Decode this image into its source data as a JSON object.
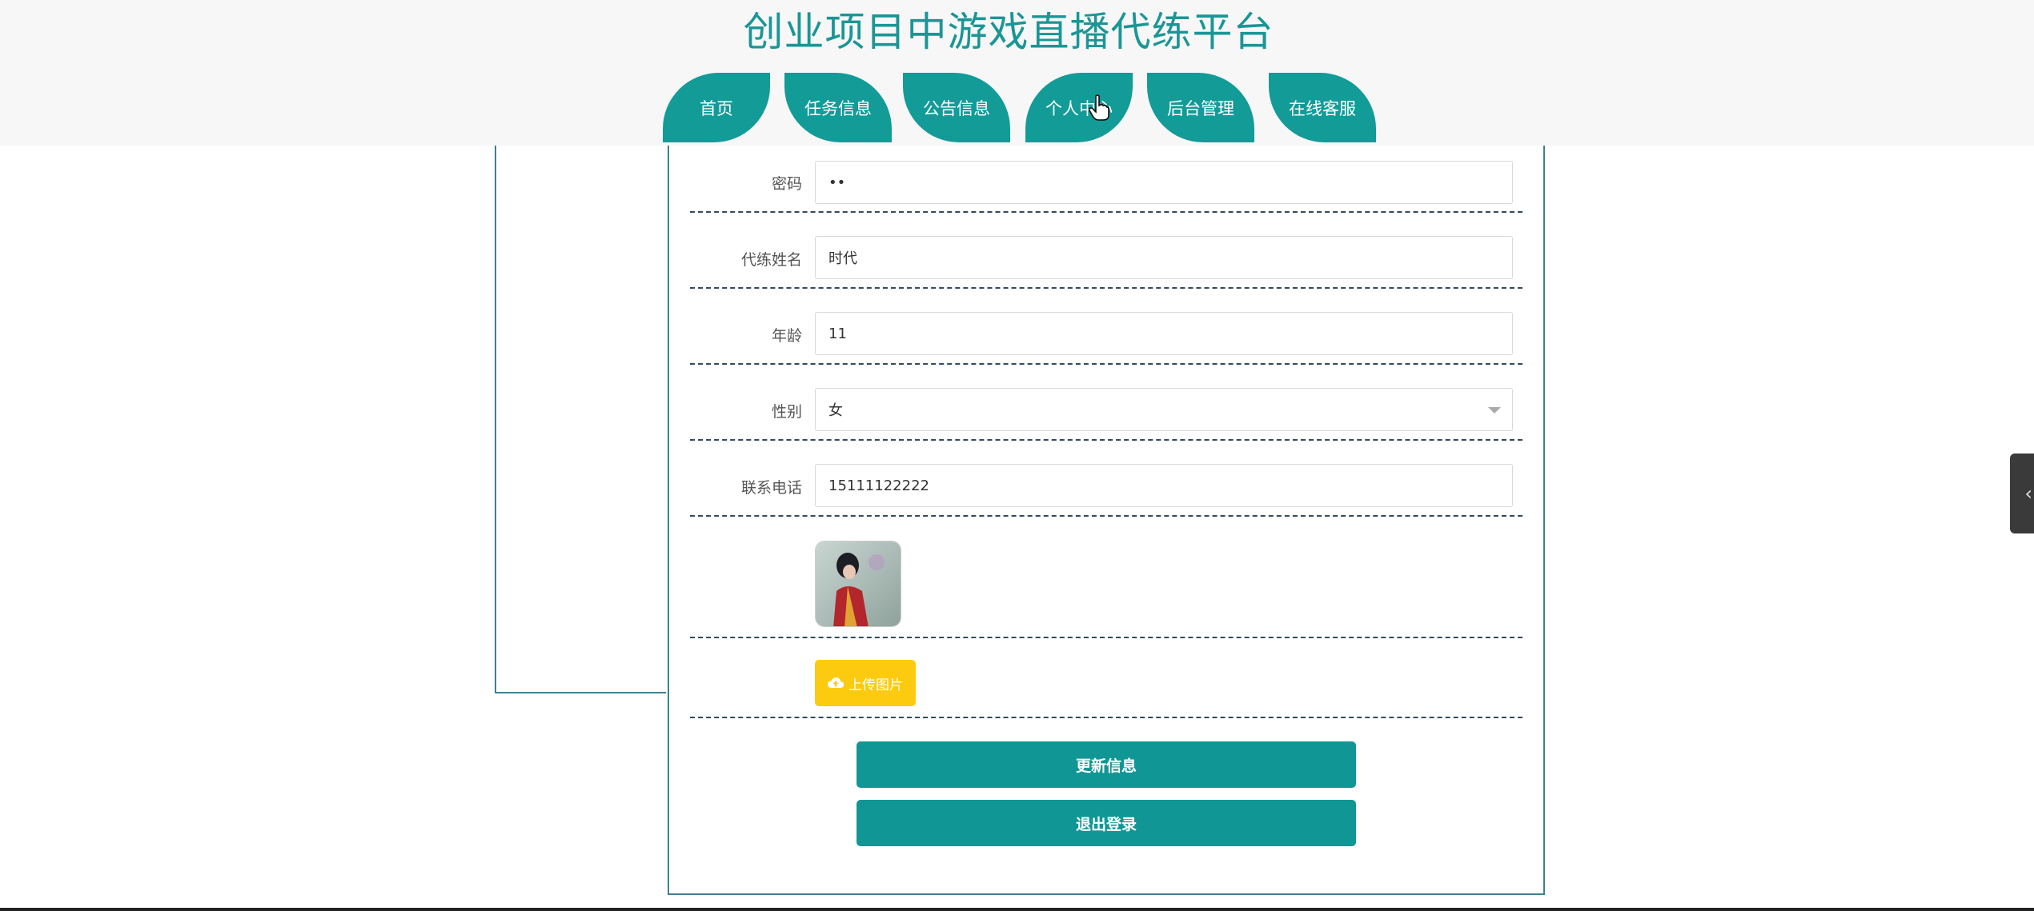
{
  "site": {
    "title": "创业项目中游戏直播代练平台"
  },
  "nav": {
    "items": [
      {
        "label": "首页"
      },
      {
        "label": "任务信息"
      },
      {
        "label": "公告信息"
      },
      {
        "label": "个人中心"
      },
      {
        "label": "后台管理"
      },
      {
        "label": "在线客服"
      }
    ],
    "active": "个人中心"
  },
  "form": {
    "password": {
      "label": "密码",
      "value": "••"
    },
    "name": {
      "label": "代练姓名",
      "value": "时代"
    },
    "age": {
      "label": "年龄",
      "value": "11"
    },
    "gender": {
      "label": "性别",
      "value": "女"
    },
    "phone": {
      "label": "联系电话",
      "value": "15111122222"
    },
    "upload_label": "上传图片",
    "update_label": "更新信息",
    "logout_label": "退出登录"
  },
  "colors": {
    "brand": "#139b98",
    "upload": "#fccb0f",
    "border": "#3f7f95"
  },
  "icons": {
    "upload": "cloud-upload-icon",
    "side_tab": "chevron-left-icon",
    "select": "chevron-down-icon"
  }
}
